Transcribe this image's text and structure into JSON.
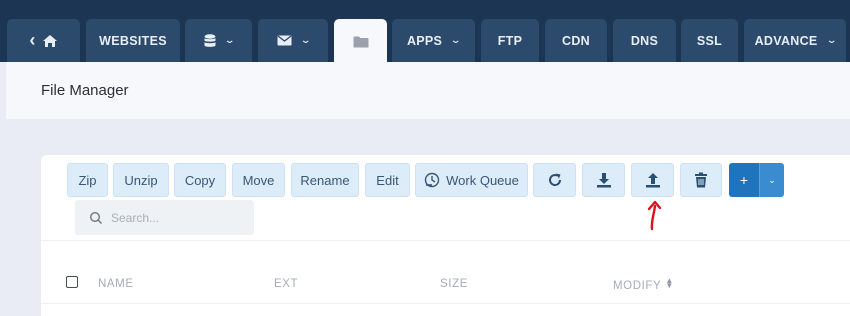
{
  "nav": {
    "tabs": [
      {
        "id": "home",
        "label": "",
        "icon": "home-icon"
      },
      {
        "id": "websites",
        "label": "WEBSITES"
      },
      {
        "id": "database",
        "label": "",
        "icon": "database-icon",
        "dropdown": true
      },
      {
        "id": "email",
        "label": "",
        "icon": "envelope-icon",
        "dropdown": true
      },
      {
        "id": "files",
        "label": "",
        "icon": "folder-icon",
        "active": true
      },
      {
        "id": "apps",
        "label": "APPS",
        "dropdown": true
      },
      {
        "id": "ftp",
        "label": "FTP"
      },
      {
        "id": "cdn",
        "label": "CDN"
      },
      {
        "id": "dns",
        "label": "DNS"
      },
      {
        "id": "ssl",
        "label": "SSL"
      },
      {
        "id": "advance",
        "label": "ADVANCE",
        "dropdown": true
      }
    ],
    "back_glyph": "‹",
    "caret_glyph": "⌄"
  },
  "page": {
    "title": "File Manager"
  },
  "toolbar": {
    "zip": "Zip",
    "unzip": "Unzip",
    "copy": "Copy",
    "move": "Move",
    "rename": "Rename",
    "edit": "Edit",
    "work_queue": "Work Queue",
    "refresh_icon": "refresh-icon",
    "download_icon": "download-icon",
    "upload_icon": "upload-icon",
    "delete_icon": "trash-icon",
    "new_label": "+",
    "new_caret": "⌄"
  },
  "search": {
    "placeholder": "Search..."
  },
  "table": {
    "columns": [
      "NAME",
      "EXT",
      "SIZE",
      "MODIFY"
    ],
    "sortable_column": "MODIFY"
  },
  "annotation": {
    "color": "#e0101a"
  },
  "colors": {
    "nav_bg": "#1b3553",
    "tab_bg": "#2c4a6c",
    "button_bg": "#dcecf9",
    "primary": "#1f74bd"
  }
}
